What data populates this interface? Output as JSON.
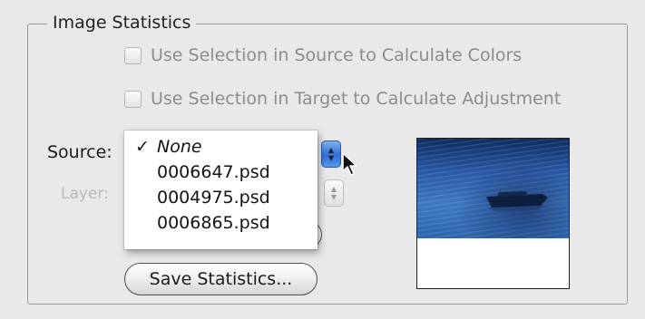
{
  "group": {
    "title": "Image Statistics"
  },
  "checkboxes": {
    "source_selection_label": "Use Selection in Source to Calculate Colors",
    "target_selection_label": "Use Selection in Target to Calculate Adjustment",
    "source_selection_checked": false,
    "target_selection_checked": false
  },
  "source": {
    "label": "Source:",
    "selected": "None"
  },
  "layer": {
    "label": "Layer:"
  },
  "menu": {
    "checkmark": "✓",
    "items": [
      "None",
      "0006647.psd",
      "0004975.psd",
      "0006865.psd"
    ]
  },
  "buttons": {
    "save_statistics": "Save Statistics..."
  },
  "icons": {
    "stepper_up": "▲",
    "stepper_down": "▼"
  },
  "colors": {
    "accent_blue": "#2f6ed6",
    "disabled_text": "#8c8c8c"
  }
}
